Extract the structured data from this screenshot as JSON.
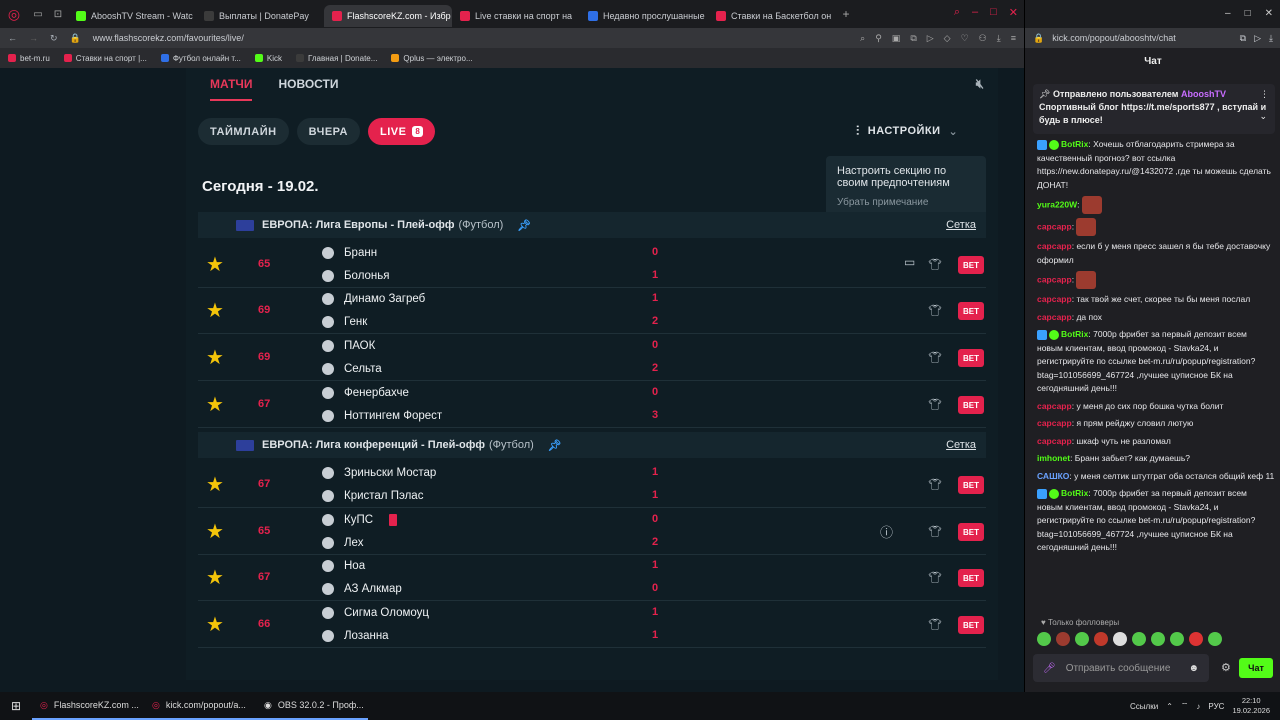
{
  "left_browser": {
    "tabs": [
      {
        "label": "AbooshTV Stream - Watc",
        "color": "#53fc18"
      },
      {
        "label": "Выплаты | DonatePay",
        "color": "#3b3b3b"
      },
      {
        "label": "FlashscoreKZ.com - Избр",
        "color": "#e4224d"
      },
      {
        "label": "Live ставки на спорт на",
        "color": "#e4224d"
      },
      {
        "label": "Недавно прослушанные",
        "color": "#2f6fe6"
      },
      {
        "label": "Ставки на Баскетбол он",
        "color": "#e4224d"
      }
    ],
    "url": "www.flashscorekz.com/favourites/live/",
    "bookmarks": [
      "bet-m.ru",
      "Ставки на спорт |...",
      "Футбол онлайн т...",
      "Kick",
      "Главная | Donate...",
      "Qplus — электро..."
    ]
  },
  "site": {
    "nav": {
      "matches": "МАТЧИ",
      "news": "НОВОСТИ"
    },
    "filters": {
      "timeline": "ТАЙМЛАЙН",
      "yesterday": "ВЧЕРА",
      "live": "LIVE",
      "live_count": "8"
    },
    "settings_label": "НАСТРОЙКИ",
    "tooltip": {
      "text": "Настроить секцию по своим предпочтениям",
      "remove": "Убрать примечание"
    },
    "date_title": "Сегодня - 19.02.",
    "bet_label": "BET",
    "grid_label": "Сетка",
    "leagues": [
      {
        "name": "ЕВРОПА: Лига Европы - Плей-офф",
        "sport": "(Футбол)"
      },
      {
        "name": "ЕВРОПА: Лига конференций - Плей-офф",
        "sport": "(Футбол)"
      }
    ],
    "matches": [
      {
        "minute": "65",
        "home": "Бранн",
        "away": "Болонья",
        "hs": "0",
        "as": "1"
      },
      {
        "minute": "69",
        "home": "Динамо Загреб",
        "away": "Генк",
        "hs": "1",
        "as": "2"
      },
      {
        "minute": "69",
        "home": "ПАОК",
        "away": "Сельта",
        "hs": "0",
        "as": "2"
      },
      {
        "minute": "67",
        "home": "Фенербахче",
        "away": "Ноттингем Форест",
        "hs": "0",
        "as": "3"
      },
      {
        "minute": "67",
        "home": "Зриньски Мостар",
        "away": "Кристал Пэлас",
        "hs": "1",
        "as": "1"
      },
      {
        "minute": "65",
        "home": "КуПС",
        "away": "Лех",
        "hs": "0",
        "as": "2"
      },
      {
        "minute": "67",
        "home": "Ноа",
        "away": "АЗ Алкмар",
        "hs": "1",
        "as": "0"
      },
      {
        "minute": "66",
        "home": "Сигма Оломоуц",
        "away": "Лозанна",
        "hs": "1",
        "as": "1"
      }
    ]
  },
  "chat": {
    "url": "kick.com/popout/abooshtv/chat",
    "title": "Чат",
    "pinned_by": "Отправлено пользователем",
    "pinned_user": "AbooshTV",
    "pinned_text": "Спортивный блог https://t.me/sports877 , вступай и будь в плюсе!",
    "messages": [
      {
        "user": "BotRix",
        "color": "#53fc18",
        "text": "Хочешь отблагодарить стримера за качественный прогноз? вот ссылка https://new.donatepay.ru/@1432072 ,где ты можешь сделать ДОНАТ!"
      },
      {
        "user": "yura220W",
        "color": "#53fc18",
        "text": ""
      },
      {
        "user": "сарсарр",
        "color": "#e4224d",
        "text": ""
      },
      {
        "user": "сарсарр",
        "color": "#e4224d",
        "text": "если б у меня пресс зашел я бы тебе доставочку оформил"
      },
      {
        "user": "сарсарр",
        "color": "#e4224d",
        "text": ""
      },
      {
        "user": "сарсарр",
        "color": "#e4224d",
        "text": "так твой же счет, скорее ты бы меня послал"
      },
      {
        "user": "сарсарр",
        "color": "#e4224d",
        "text": "да пох"
      },
      {
        "user": "BotRix",
        "color": "#53fc18",
        "text": "7000р фрибет за первый депозит всем новым клиентам, ввод промокод - Stavka24, и регистрируйте по ссылке bet-m.ru/ru/popup/registration?btag=101056699_467724 ,лучшее цуписное БК на сегодняшний день!!!"
      },
      {
        "user": "сарсарр",
        "color": "#e4224d",
        "text": "у меня дo сих пор бошка чутка болит"
      },
      {
        "user": "сарсарр",
        "color": "#e4224d",
        "text": "я прям рейджу словил лютую"
      },
      {
        "user": "сарсарр",
        "color": "#e4224d",
        "text": "шкаф чуть не разломал"
      },
      {
        "user": "imhonet",
        "color": "#53fc18",
        "text": "Бранн забьет? как думаешь?"
      },
      {
        "user": "САШКО",
        "color": "#6aa2ff",
        "text": "у меня селтик штутграт оба остался общий кеф 11"
      },
      {
        "user": "BotRix",
        "color": "#53fc18",
        "text": "7000р фрибет за первый депозит всем новым клиентам, ввод промокод - Stavka24, и регистрируйте по ссылке bet-m.ru/ru/popup/registration?btag=101056699_467724 ,лучшее цуписное БК на сегодняшний день!!!"
      }
    ],
    "followers_only": "Только фолловеры",
    "placeholder": "Отправить сообщение",
    "send_label": "Чат"
  },
  "taskbar": {
    "apps": [
      "FlashscoreKZ.com ...",
      "kick.com/popout/a...",
      "OBS 32.0.2 - Проф..."
    ],
    "links": "Ссылки",
    "lang": "РУС",
    "time": "22:10",
    "date": "19.02.2026"
  }
}
